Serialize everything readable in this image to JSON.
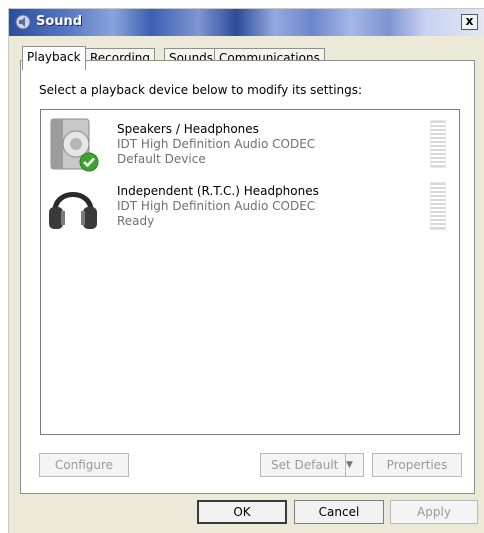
{
  "window": {
    "title": "Sound",
    "close_label": "x"
  },
  "tabs": [
    {
      "label": "Playback",
      "active": true
    },
    {
      "label": "Recording"
    },
    {
      "label": "Sounds"
    },
    {
      "label": "Communications"
    }
  ],
  "instruction": "Select a playback device below to modify its settings:",
  "devices": [
    {
      "name": "Speakers / Headphones",
      "driver": "IDT High Definition Audio CODEC",
      "status": "Default Device",
      "icon": "speaker-icon",
      "badge": "default-check-icon"
    },
    {
      "name": "Independent (R.T.C.) Headphones",
      "driver": "IDT High Definition Audio CODEC",
      "status": "Ready",
      "icon": "headphones-icon"
    }
  ],
  "panel_buttons": {
    "configure": "Configure",
    "set_default": "Set Default",
    "properties": "Properties"
  },
  "dialog_buttons": {
    "ok": "OK",
    "cancel": "Cancel",
    "apply": "Apply"
  },
  "colors": {
    "title_gradient_start": "#2a4f9e",
    "check_green": "#3aa52e",
    "disabled_text": "#9a9a9a"
  }
}
